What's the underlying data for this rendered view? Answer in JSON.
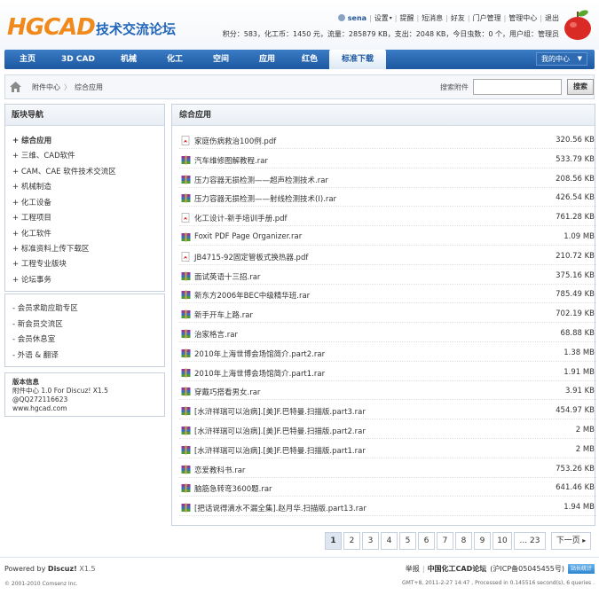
{
  "header": {
    "logo_en": "HGCAD",
    "logo_cn": "技术交流论坛",
    "user": {
      "name": "sena",
      "links": [
        "设置",
        "提醒",
        "短消息",
        "好友",
        "门户管理",
        "管理中心",
        "退出"
      ]
    },
    "stats": "积分：583，化工币：1450 元，流量：285879 KB，支出：2048 KB，今日虫数：0 个，用户组：管理员"
  },
  "nav": {
    "items": [
      "主页",
      "3D CAD",
      "机械",
      "化工",
      "空间",
      "应用",
      "红色",
      "标准下载"
    ],
    "active_index": 7,
    "my_center": "我的中心"
  },
  "breadcrumb": {
    "items": [
      "附件中心",
      "综合应用"
    ],
    "search_label": "搜索附件",
    "search_value": "",
    "search_button": "搜索"
  },
  "sidebar": {
    "nav_title": "版块导航",
    "nav_items": [
      {
        "label": "+ 综合应用",
        "bold": true
      },
      {
        "label": "+ 三维、CAD软件",
        "bold": false
      },
      {
        "label": "+ CAM、CAE 软件技术交流区",
        "bold": false
      },
      {
        "label": "+ 机械制造",
        "bold": false
      },
      {
        "label": "+ 化工设备",
        "bold": false
      },
      {
        "label": "+ 工程项目",
        "bold": false
      },
      {
        "label": "+ 化工软件",
        "bold": false
      },
      {
        "label": "+ 标准资料上传下载区",
        "bold": false
      },
      {
        "label": "+ 工程专业版块",
        "bold": false
      },
      {
        "label": "+ 论坛事务",
        "bold": false
      }
    ],
    "member_items": [
      "- 会员求助应助专区",
      "- 新会员交流区",
      "- 会员休息室",
      "- 外语 & 翻译"
    ],
    "info_title": "版本信息",
    "info_lines": [
      "附件中心 1.0 For Discuz! X1.5",
      "@QQ272116623",
      "www.hgcad.com"
    ]
  },
  "main": {
    "title": "综合应用",
    "files": [
      {
        "name": "家庭伤病救治100例.pdf",
        "size": "320.56 KB",
        "type": "pdf"
      },
      {
        "name": "汽车维修图解教程.rar",
        "size": "533.79 KB",
        "type": "rar"
      },
      {
        "name": "压力容器无损检测——超声检测技术.rar",
        "size": "208.56 KB",
        "type": "rar"
      },
      {
        "name": "压力容器无损检测——射线检测技术(Ⅰ).rar",
        "size": "426.54 KB",
        "type": "rar"
      },
      {
        "name": "化工设计-新手培训手册.pdf",
        "size": "761.28 KB",
        "type": "pdf"
      },
      {
        "name": "Foxit PDF Page Organizer.rar",
        "size": "1.09 MB",
        "type": "rar"
      },
      {
        "name": "JB4715-92固定管板式换热器.pdf",
        "size": "210.72 KB",
        "type": "pdf"
      },
      {
        "name": "面试英语十三招.rar",
        "size": "375.16 KB",
        "type": "rar"
      },
      {
        "name": "新东方2006年BEC中级精华班.rar",
        "size": "785.49 KB",
        "type": "rar"
      },
      {
        "name": "新手开车上路.rar",
        "size": "702.19 KB",
        "type": "rar"
      },
      {
        "name": "治家格言.rar",
        "size": "68.88 KB",
        "type": "rar"
      },
      {
        "name": "2010年上海世博会场馆简介.part2.rar",
        "size": "1.38 MB",
        "type": "rar"
      },
      {
        "name": "2010年上海世博会场馆简介.part1.rar",
        "size": "1.91 MB",
        "type": "rar"
      },
      {
        "name": "穿戴巧搭看男女.rar",
        "size": "3.91 KB",
        "type": "rar"
      },
      {
        "name": "[水浒祥瑞可以治病].[美]F.巴特曼.扫描版.part3.rar",
        "size": "454.97 KB",
        "type": "rar"
      },
      {
        "name": "[水浒祥瑞可以治病].[美]F.巴特曼.扫描版.part2.rar",
        "size": "2 MB",
        "type": "rar"
      },
      {
        "name": "[水浒祥瑞可以治病].[美]F.巴特曼.扫描版.part1.rar",
        "size": "2 MB",
        "type": "rar"
      },
      {
        "name": "恋爱教科书.rar",
        "size": "753.26 KB",
        "type": "rar"
      },
      {
        "name": "脑筋急转弯3600题.rar",
        "size": "641.46 KB",
        "type": "rar"
      },
      {
        "name": "[把话说得滴水不漏全集].赵月华.扫描版.part13.rar",
        "size": "1.94 MB",
        "type": "rar"
      }
    ]
  },
  "pagination": {
    "pages": [
      "1",
      "2",
      "3",
      "4",
      "5",
      "6",
      "7",
      "8",
      "9",
      "10",
      "... 23"
    ],
    "current": "1",
    "next": "下一页"
  },
  "footer": {
    "powered_prefix": "Powered by",
    "powered_brand": "Discuz!",
    "powered_version": "X1.5",
    "copyright": "© 2001-2010 Comsenz Inc.",
    "links": [
      "举报",
      "中国化工CAD论坛",
      "(沪ICP备05045455号)"
    ],
    "badge": "站长统计",
    "time": "GMT+8, 2011-2-27 14:47 , Processed in 0.145516 second(s), 6 queries ."
  },
  "colors": {
    "nav_bg": "#1d58a0",
    "logo_orange": "#f08a1c",
    "logo_blue": "#2266bb",
    "border": "#c7d1dd"
  }
}
